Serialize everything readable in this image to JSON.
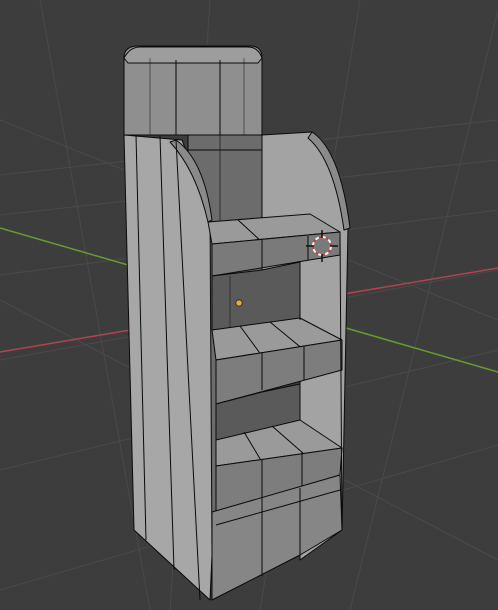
{
  "app": {
    "editor": "3d-viewport",
    "view_mode": "edit-mode-wireframe-overlay"
  },
  "colors": {
    "background": "#3d3d3d",
    "grid_line": "#4a4a4a",
    "x_axis": "#b3434f",
    "y_axis": "#6a9a2e",
    "mesh_face_light": "#a7a7a7",
    "mesh_face_mid": "#8f8f8f",
    "mesh_face_dark": "#6c6c6c",
    "mesh_face_darker": "#5a5a5a",
    "edge": "#0a0a0a",
    "origin_dot": "#f2a33a",
    "cursor_ring_red": "#d23b3b",
    "cursor_ring_white": "#f3f3f3"
  },
  "scene": {
    "object": "display-stand-mesh",
    "has_3d_cursor": true,
    "has_object_origin": true
  }
}
